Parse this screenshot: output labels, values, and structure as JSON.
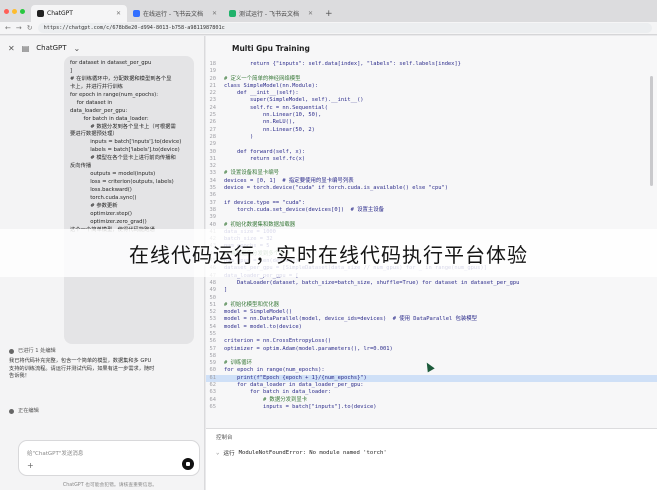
{
  "browser": {
    "tabs": [
      {
        "title": "ChatGPT",
        "color": "#222222"
      },
      {
        "title": "在线运行 - 飞书云文档",
        "color": "#3370ff"
      },
      {
        "title": "测试运行 - 飞书云文档",
        "color": "#20b26b"
      }
    ],
    "url": "https://chatgpt.com/c/678b8e20-d994-8013-b758-a9811987801c"
  },
  "chat": {
    "app_title": "ChatGPT",
    "message_lines": [
      "for dataset in dataset_per_gpu",
      "]",
      "",
      "# 在训练循环中，分配数据和模型到各个显",
      "卡上，并进行并行训练",
      "for epoch in range(num_epochs):",
      "    for dataset in",
      "data_loader_per_gpu:",
      "        for batch in data_loader:",
      "            # 数据分发到各个显卡上（可根据需",
      "要进行数据预处理）",
      "            inputs = batch['inputs'].to(device)",
      "            labels = batch['labels'].to(device)",
      "",
      "            # 模型在各个显卡上进行前向传播和",
      "反向传播",
      "            outputs = model(inputs)",
      "            loss = criterion(outputs, labels)",
      "            loss.backward()",
      "",
      "",
      "            torch.cuda.sync()",
      "",
      "            # 参数更新",
      "            optimizer.step()",
      "            optimizer.zero_grad()",
      "",
      "这个一个简单模型，使得代码能跑通"
    ],
    "status_1_title": "已进行 1 处编辑",
    "status_1_body": [
      "我已将代码补充完整，包含一个简单的模型，数据集和多 GPU",
      "支持的训练流程。请运行并测试代码，如果有进一步需求，随时",
      "告诉我！"
    ],
    "status_2_title": "正在编辑",
    "input_placeholder": "给\"ChatGPT\"发送消息",
    "disclaimer": "ChatGPT 也可能会犯错。请核查重要信息。"
  },
  "notebook": {
    "title": "Multi Gpu Training",
    "code": [
      {
        "n": "18",
        "t": "        return {\"inputs\": self.data[index], \"labels\": self.labels[index]}"
      },
      {
        "n": "19",
        "t": ""
      },
      {
        "n": "20",
        "t": "# 定义一个简单的神经网络模型",
        "c": true
      },
      {
        "n": "21",
        "t": "class SimpleModel(nn.Module):"
      },
      {
        "n": "22",
        "t": "    def __init__(self):"
      },
      {
        "n": "23",
        "t": "        super(SimpleModel, self).__init__()"
      },
      {
        "n": "24",
        "t": "        self.fc = nn.Sequential("
      },
      {
        "n": "25",
        "t": "            nn.Linear(10, 50),"
      },
      {
        "n": "26",
        "t": "            nn.ReLU(),"
      },
      {
        "n": "27",
        "t": "            nn.Linear(50, 2)"
      },
      {
        "n": "28",
        "t": "        )"
      },
      {
        "n": "29",
        "t": ""
      },
      {
        "n": "30",
        "t": "    def forward(self, x):"
      },
      {
        "n": "31",
        "t": "        return self.fc(x)"
      },
      {
        "n": "32",
        "t": ""
      },
      {
        "n": "33",
        "t": "# 设置设备和显卡编号",
        "c": true
      },
      {
        "n": "34",
        "t": "devices = [0, 1]  # 指定要使用的显卡编号列表"
      },
      {
        "n": "35",
        "t": "device = torch.device(\"cuda\" if torch.cuda.is_available() else \"cpu\")"
      },
      {
        "n": "36",
        "t": ""
      },
      {
        "n": "37",
        "t": "if device.type == \"cuda\":"
      },
      {
        "n": "38",
        "t": "    torch.cuda.set_device(devices[0])  # 设置主设备"
      },
      {
        "n": "39",
        "t": ""
      },
      {
        "n": "40",
        "t": "# 初始化数据集和数据加载器",
        "c": true
      },
      {
        "n": "41",
        "t": "data_size = 1000"
      },
      {
        "n": "42",
        "t": "batch_size = 32"
      },
      {
        "n": "43",
        "t": "num_epochs = 5"
      },
      {
        "n": "44",
        "t": "# 将数据集分发到多个显卡",
        "c": true
      },
      {
        "n": "45",
        "t": "num_gpus = len(devices)"
      },
      {
        "n": "46",
        "t": "dataset_per_gpu = [SimpleDataset(data_size // num_gpus) for _ in range(num_gpus)]"
      },
      {
        "n": "47",
        "t": "data_loader_per_gpu = ["
      },
      {
        "n": "48",
        "t": "    DataLoader(dataset, batch_size=batch_size, shuffle=True) for dataset in dataset_per_gpu"
      },
      {
        "n": "49",
        "t": "]"
      },
      {
        "n": "50",
        "t": ""
      },
      {
        "n": "51",
        "t": "# 初始化模型和优化器",
        "c": true
      },
      {
        "n": "52",
        "t": "model = SimpleModel()"
      },
      {
        "n": "53",
        "t": "model = nn.DataParallel(model, device_ids=devices)  # 使用 DataParallel 包装模型"
      },
      {
        "n": "54",
        "t": "model = model.to(device)"
      },
      {
        "n": "55",
        "t": ""
      },
      {
        "n": "56",
        "t": "criterion = nn.CrossEntropyLoss()"
      },
      {
        "n": "57",
        "t": "optimizer = optim.Adam(model.parameters(), lr=0.001)"
      },
      {
        "n": "58",
        "t": ""
      },
      {
        "n": "59",
        "t": "# 训练循环",
        "c": true
      },
      {
        "n": "60",
        "t": "for epoch in range(num_epochs):"
      },
      {
        "n": "61",
        "t": "    print(f\"Epoch {epoch + 1}/{num_epochs}\")",
        "hl": true
      },
      {
        "n": "62",
        "t": "    for data_loader in data_loader_per_gpu:"
      },
      {
        "n": "63",
        "t": "        for batch in data_loader:"
      },
      {
        "n": "64",
        "t": "            # 数据分发到显卡",
        "c": true
      },
      {
        "n": "65",
        "t": "            inputs = batch[\"inputs\"].to(device)"
      }
    ],
    "console_title": "控制台",
    "error_prefix": "运行",
    "error_text": "ModuleNotFoundError: No module named 'torch'"
  },
  "caption": "在线代码运行，实时在线代码执行平台体验"
}
